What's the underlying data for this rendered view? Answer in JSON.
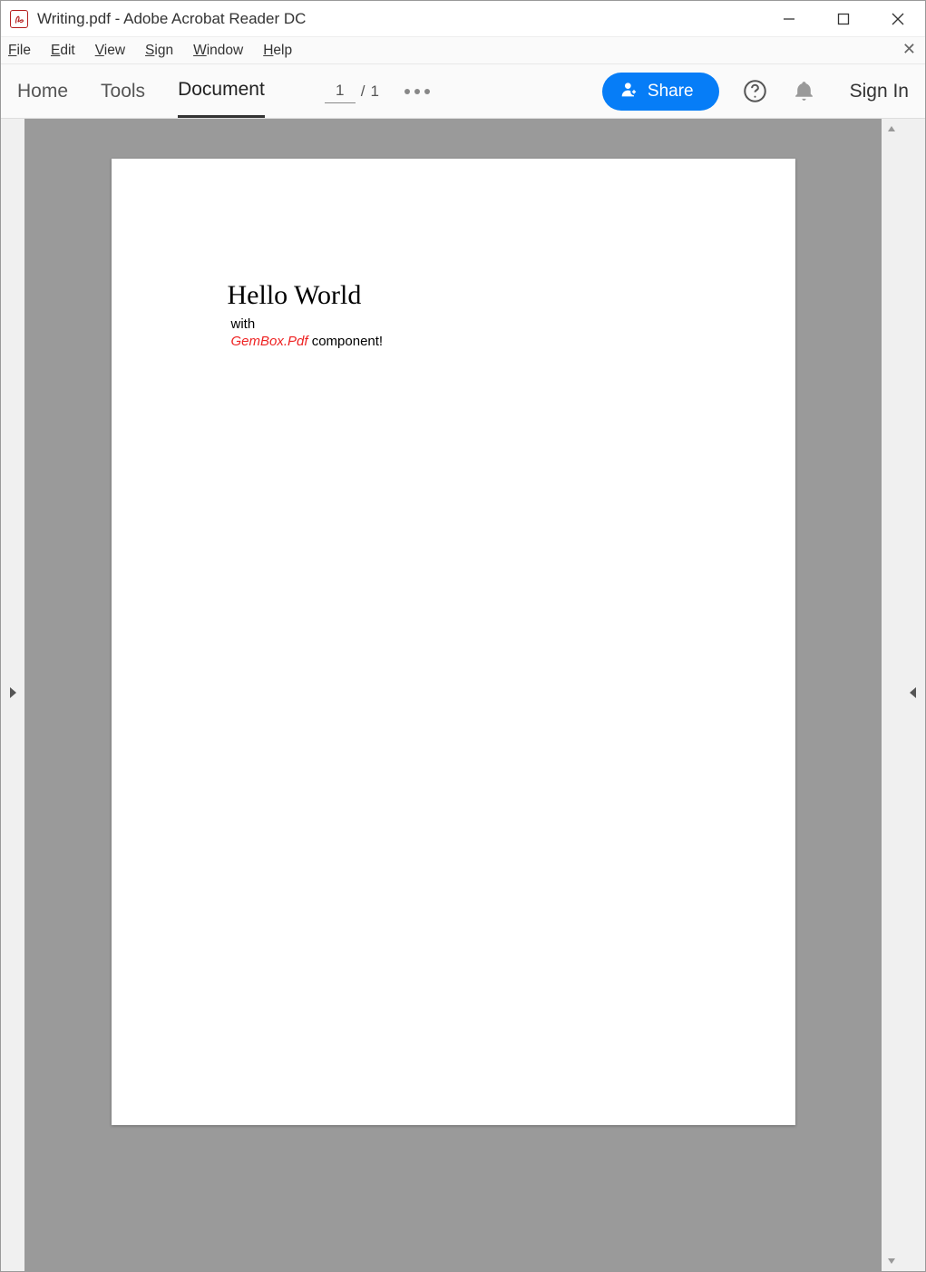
{
  "window": {
    "title": "Writing.pdf - Adobe Acrobat Reader DC"
  },
  "menubar": {
    "items": [
      {
        "u": "F",
        "rest": "ile"
      },
      {
        "u": "E",
        "rest": "dit"
      },
      {
        "u": "V",
        "rest": "iew"
      },
      {
        "u": "S",
        "rest": "ign"
      },
      {
        "u": "W",
        "rest": "indow"
      },
      {
        "u": "H",
        "rest": "elp"
      }
    ]
  },
  "tabs": {
    "home": "Home",
    "tools": "Tools",
    "document": "Document"
  },
  "page": {
    "current": "1",
    "sep": "/",
    "total": "1"
  },
  "share": {
    "label": "Share"
  },
  "signin": {
    "label": "Sign In"
  },
  "document": {
    "heading": "Hello World",
    "line2": "with",
    "line3_emph": "GemBox.Pdf",
    "line3_rest": " component!"
  }
}
